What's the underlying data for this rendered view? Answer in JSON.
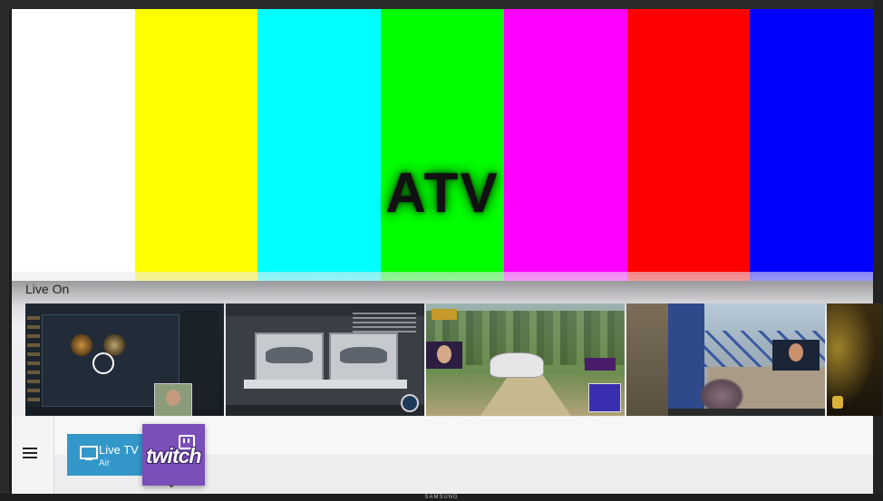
{
  "test_pattern": {
    "label": "ATV",
    "bar_colors": [
      "#ffffff",
      "#ffff00",
      "#00ffff",
      "#00ff00",
      "#ff00ff",
      "#ff0000",
      "#0000ff"
    ]
  },
  "live_on": {
    "label": "Live On"
  },
  "nav": {
    "menu_icon": "hamburger-icon",
    "live_tv": {
      "title": "Live TV",
      "subtitle": "Air",
      "icon": "tv-icon",
      "color": "#3497c9"
    },
    "twitch": {
      "logo_text": "twitch",
      "color": "#7a4fb8"
    },
    "chevron": "⌄"
  },
  "device": {
    "brand": "SAMSUNG"
  }
}
